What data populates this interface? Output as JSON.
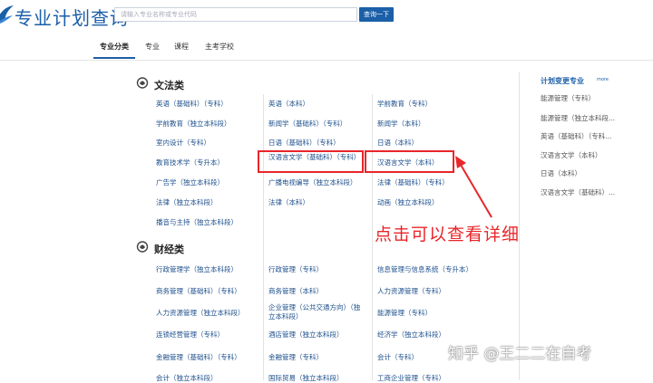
{
  "header": {
    "title": "专业计划查询",
    "search_placeholder": "请输入专业名称或专业代码",
    "search_button": "查询一下"
  },
  "nav": {
    "tabs": [
      {
        "label": "专业分类",
        "active": true
      },
      {
        "label": "专业",
        "active": false
      },
      {
        "label": "课程",
        "active": false
      },
      {
        "label": "主考学校",
        "active": false
      }
    ]
  },
  "categories": {
    "wenfa": {
      "title": "文法类",
      "items": [
        "英语（基础科）（专科）",
        "英语（本科）",
        "学前教育（专科）",
        "学前教育（独立本科段）",
        "新闻学（基础科）（专科）",
        "新闻学（本科）",
        "室内设计（专科）",
        "日语（基础科）（专科）",
        "日语（本科）",
        "教育技术学（专升本）",
        "汉语言文学（基础科）（专科）",
        "汉语言文学（本科）",
        "广告学（独立本科段）",
        "广播电视编导（独立本科段）",
        "法律（基础科）（专科）",
        "法律（独立本科段）",
        "法律（本科）",
        "动画（独立本科段）",
        "播音与主持（独立本科段）"
      ]
    },
    "caijing": {
      "title": "财经类",
      "items": [
        "行政管理学（独立本科段）",
        "行政管理（专科）",
        "信息管理与信息系统（专升本）",
        "商务管理（基础科）（专科）",
        "商务管理（本科）",
        "人力资源管理（专科）",
        "人力资源管理（独立本科段）",
        "企业管理（公共交通方向）（独立本科段）",
        "能源管理（专科）",
        "连锁经营管理（专科）",
        "酒店管理（独立本科段）",
        "经济学（独立本科段）",
        "金融管理（基础科）（专科）",
        "金融管理（专科）",
        "会计（专科）",
        "会计（独立本科段）",
        "国际贸易（独立本科段）",
        "工商企业管理（专科）"
      ]
    }
  },
  "sidebar": {
    "title": "计划变更专业",
    "more": "more",
    "items": [
      "能源管理（专科）",
      "能源管理（独立本科段...",
      "英语（基础科）（专科...",
      "汉语言文学（本科）",
      "日语（本科）",
      "汉语言文学（基础科）..."
    ]
  },
  "annotation": "点击可以查看详细",
  "watermark": "知乎 @王二二在自考",
  "colors": {
    "brand_blue": "#1b5fa8",
    "link_blue": "#1d4f8c",
    "annotation_red": "#e8262a"
  }
}
